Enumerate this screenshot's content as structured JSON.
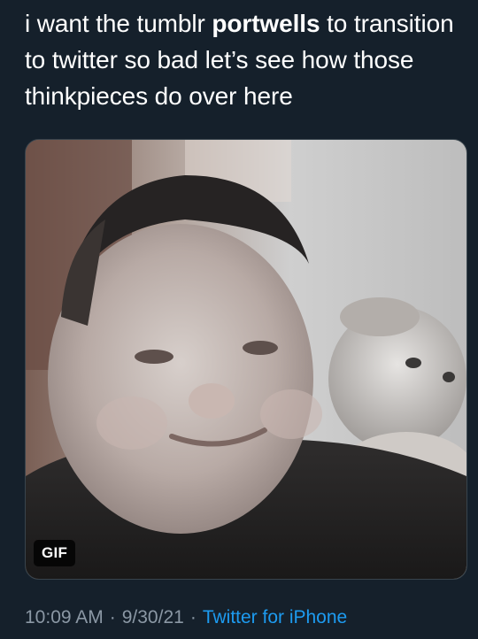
{
  "tweet": {
    "text_before": "i want the tumblr ",
    "mention": "portwells",
    "text_after": " to transition to twitter so bad let’s see how those thinkpieces do over here"
  },
  "media": {
    "badge": "GIF",
    "icon": "gif-media"
  },
  "meta": {
    "time": "10:09 AM",
    "separator": "·",
    "date": "9/30/21",
    "source": "Twitter for iPhone"
  },
  "colors": {
    "background": "#15202b",
    "text": "#ffffff",
    "secondary_text": "#8b98a5",
    "link": "#1d9bf0"
  }
}
